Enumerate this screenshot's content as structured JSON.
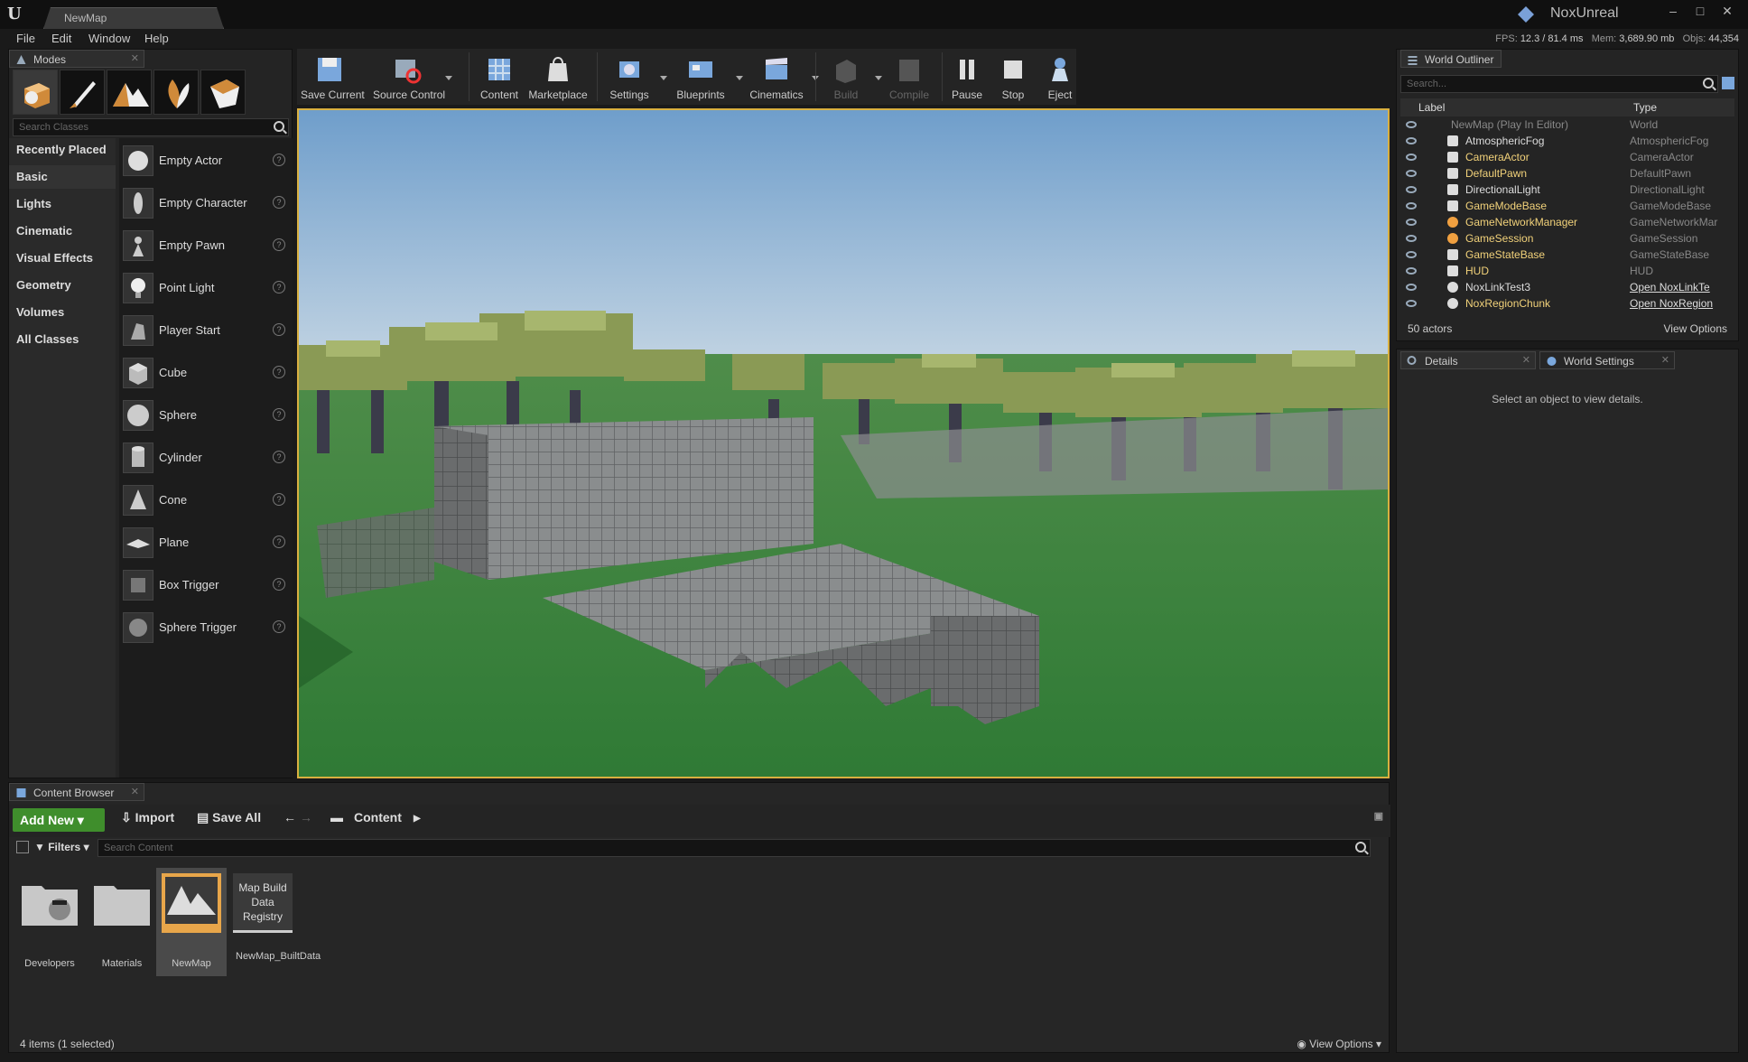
{
  "window": {
    "doc_tab": "NewMap",
    "project": "NoxUnreal"
  },
  "menu": [
    "File",
    "Edit",
    "Window",
    "Help"
  ],
  "stats": {
    "fps_label": "FPS:",
    "fps_value": "12.3 / 81.4 ms",
    "mem_label": "Mem:",
    "mem_value": "3,689.90 mb",
    "objs_label": "Objs:",
    "objs_value": "44,354"
  },
  "modes": {
    "tab": "Modes",
    "search_placeholder": "Search Classes",
    "categories": [
      "Recently Placed",
      "Basic",
      "Lights",
      "Cinematic",
      "Visual Effects",
      "Geometry",
      "Volumes",
      "All Classes"
    ],
    "items": [
      "Empty Actor",
      "Empty Character",
      "Empty Pawn",
      "Point Light",
      "Player Start",
      "Cube",
      "Sphere",
      "Cylinder",
      "Cone",
      "Plane",
      "Box Trigger",
      "Sphere Trigger"
    ]
  },
  "toolbar": [
    "Save Current",
    "Source Control",
    "Content",
    "Marketplace",
    "Settings",
    "Blueprints",
    "Cinematics",
    "Build",
    "Compile",
    "Pause",
    "Stop",
    "Eject"
  ],
  "outliner": {
    "tab": "World Outliner",
    "search_placeholder": "Search...",
    "col_label": "Label",
    "col_type": "Type",
    "rows": [
      {
        "name": "NewMap (Play In Editor)",
        "type": "World"
      },
      {
        "name": "AtmosphericFog",
        "type": "AtmosphericFog"
      },
      {
        "name": "CameraActor",
        "type": "CameraActor"
      },
      {
        "name": "DefaultPawn",
        "type": "DefaultPawn"
      },
      {
        "name": "DirectionalLight",
        "type": "DirectionalLight"
      },
      {
        "name": "GameModeBase",
        "type": "GameModeBase"
      },
      {
        "name": "GameNetworkManager",
        "type": "GameNetworkMar"
      },
      {
        "name": "GameSession",
        "type": "GameSession"
      },
      {
        "name": "GameStateBase",
        "type": "GameStateBase"
      },
      {
        "name": "HUD",
        "type": "HUD"
      },
      {
        "name": "NoxLinkTest3",
        "type": "Open NoxLinkTe"
      },
      {
        "name": "NoxRegionChunk",
        "type": "Open NoxRegion"
      }
    ],
    "count": "50 actors",
    "view_options": "View Options"
  },
  "details": {
    "tab1": "Details",
    "tab2": "World Settings",
    "empty": "Select an object to view details."
  },
  "content_browser": {
    "tab": "Content Browser",
    "add_new": "Add New",
    "import": "Import",
    "save_all": "Save All",
    "path": "Content",
    "filters": "Filters",
    "search_placeholder": "Search Content",
    "assets": [
      "Developers",
      "Materials",
      "NewMap",
      "NewMap_BuiltData"
    ],
    "registry_label": "Map Build Data Registry",
    "status": "4 items (1 selected)",
    "view_options": "View Options"
  }
}
